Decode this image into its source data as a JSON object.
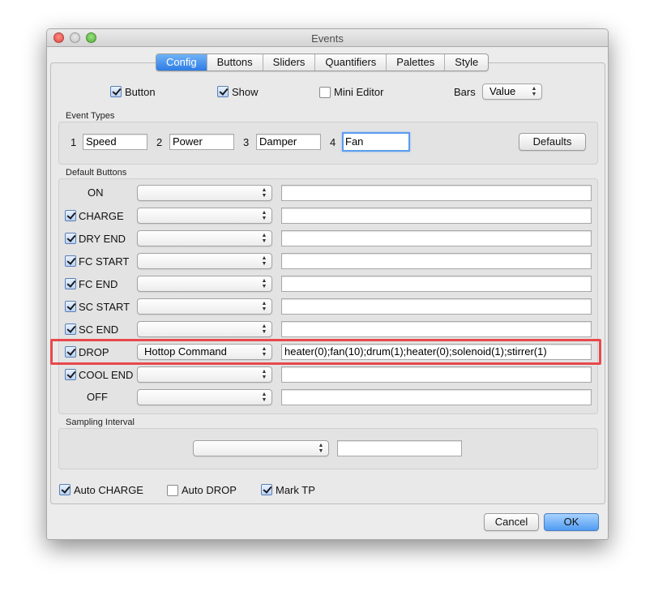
{
  "window": {
    "title": "Events"
  },
  "tabs": [
    "Config",
    "Buttons",
    "Sliders",
    "Quantifiers",
    "Palettes",
    "Style"
  ],
  "top_options": {
    "button": {
      "label": "Button",
      "checked": true
    },
    "show": {
      "label": "Show",
      "checked": true
    },
    "mini_editor": {
      "label": "Mini Editor",
      "checked": false
    },
    "bars_label": "Bars",
    "bars_value": "Value"
  },
  "event_types": {
    "title": "Event Types",
    "items": [
      {
        "num": "1",
        "value": "Speed"
      },
      {
        "num": "2",
        "value": "Power"
      },
      {
        "num": "3",
        "value": "Damper"
      },
      {
        "num": "4",
        "value": "Fan"
      }
    ],
    "defaults_label": "Defaults"
  },
  "default_buttons": {
    "title": "Default Buttons",
    "rows": [
      {
        "label": "ON",
        "has_check": false,
        "checked": false,
        "action": "",
        "command": ""
      },
      {
        "label": "CHARGE",
        "has_check": true,
        "checked": true,
        "action": "",
        "command": ""
      },
      {
        "label": "DRY END",
        "has_check": true,
        "checked": true,
        "action": "",
        "command": ""
      },
      {
        "label": "FC START",
        "has_check": true,
        "checked": true,
        "action": "",
        "command": ""
      },
      {
        "label": "FC END",
        "has_check": true,
        "checked": true,
        "action": "",
        "command": ""
      },
      {
        "label": "SC START",
        "has_check": true,
        "checked": true,
        "action": "",
        "command": ""
      },
      {
        "label": "SC END",
        "has_check": true,
        "checked": true,
        "action": "",
        "command": ""
      },
      {
        "label": "DROP",
        "has_check": true,
        "checked": true,
        "action": "Hottop Command",
        "command": "heater(0);fan(10);drum(1);heater(0);solenoid(1);stirrer(1)"
      },
      {
        "label": "COOL END",
        "has_check": true,
        "checked": true,
        "action": "",
        "command": ""
      },
      {
        "label": "OFF",
        "has_check": false,
        "checked": false,
        "action": "",
        "command": ""
      }
    ]
  },
  "sampling": {
    "title": "Sampling Interval",
    "action": "",
    "command": ""
  },
  "bottom_options": {
    "auto_charge": {
      "label": "Auto CHARGE",
      "checked": true
    },
    "auto_drop": {
      "label": "Auto DROP",
      "checked": false
    },
    "mark_tp": {
      "label": "Mark TP",
      "checked": true
    }
  },
  "buttons": {
    "cancel": "Cancel",
    "ok": "OK"
  },
  "colors": {
    "accent": "#2e7ce5",
    "highlight": "#e8484b"
  }
}
